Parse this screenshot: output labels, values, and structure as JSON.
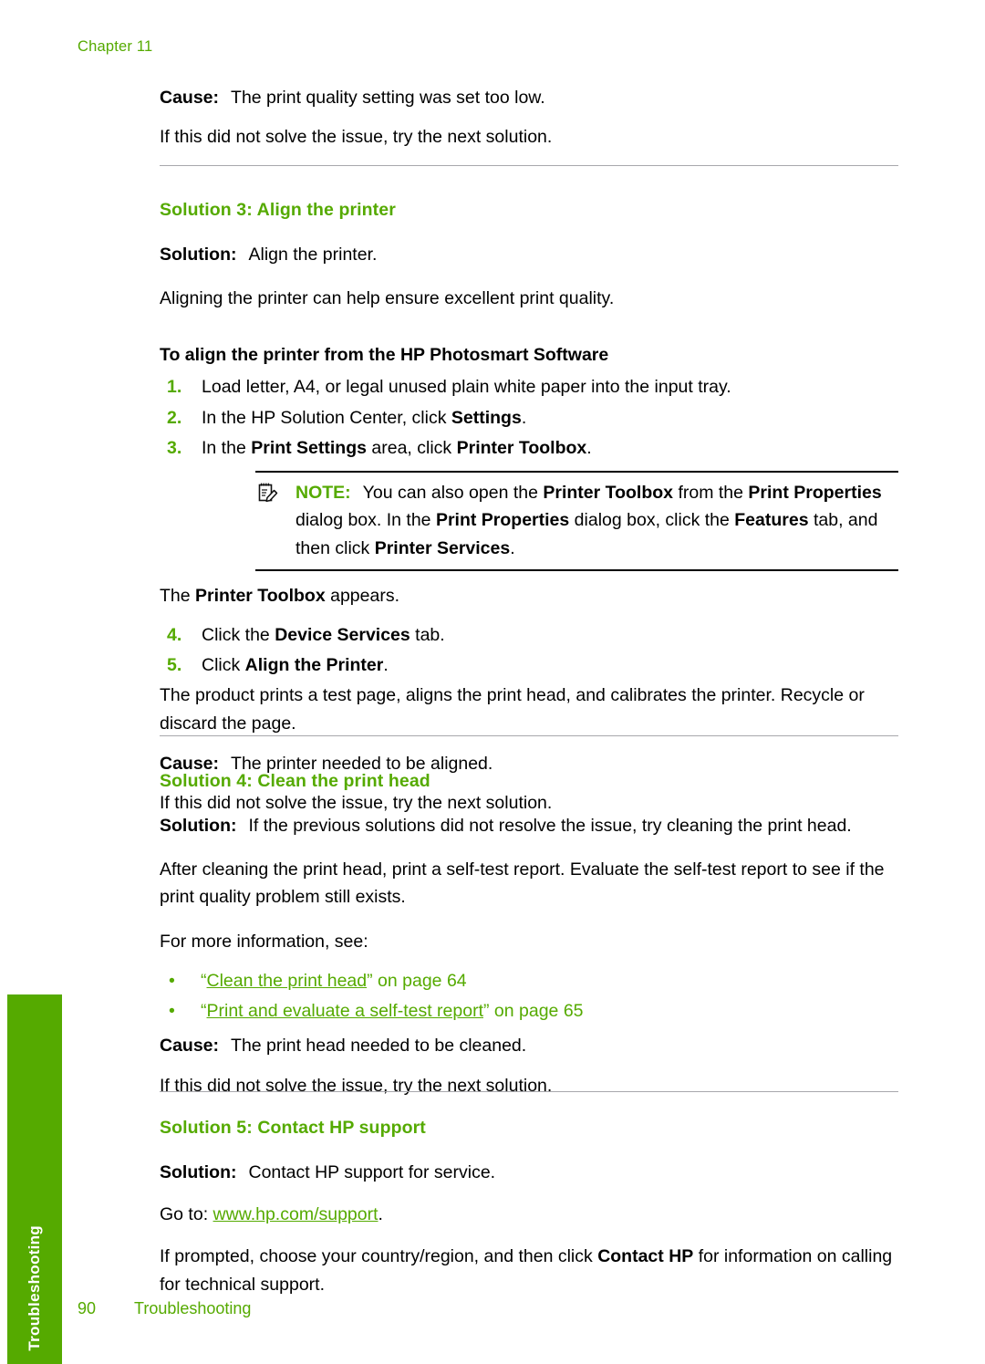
{
  "page": {
    "chapter_label": "Chapter 11",
    "footer_page_number": "90",
    "footer_section": "Troubleshooting",
    "side_tab_label": "Troubleshooting",
    "accent_green": "#55aa00",
    "rule_gray": "#a8a8ac",
    "text_black": "#000000"
  },
  "intro": {
    "cause_label": "Cause:",
    "cause_text": "The print quality setting was set too low.",
    "next_solution_text": "If this did not solve the issue, try the next solution."
  },
  "solution3": {
    "heading": "Solution 3: Align the printer",
    "solution_label": "Solution:",
    "solution_text": "Align the printer.",
    "paragraph": "Aligning the printer can help ensure excellent print quality.",
    "procedure_heading": "To align the printer from the HP Photosmart Software",
    "steps": [
      {
        "num": "1.",
        "parts": [
          {
            "t": "Load letter, A4, or legal unused plain white paper into the input tray.",
            "b": false
          }
        ]
      },
      {
        "num": "2.",
        "parts": [
          {
            "t": "In the HP Solution Center, click ",
            "b": false
          },
          {
            "t": "Settings",
            "b": true
          },
          {
            "t": ".",
            "b": false
          }
        ]
      },
      {
        "num": "3.",
        "parts": [
          {
            "t": "In the ",
            "b": false
          },
          {
            "t": "Print Settings",
            "b": true
          },
          {
            "t": " area, click ",
            "b": false
          },
          {
            "t": "Printer Toolbox",
            "b": true
          },
          {
            "t": ".",
            "b": false
          }
        ]
      }
    ],
    "note": {
      "icon": "note-pencil-icon",
      "label": "NOTE:",
      "parts": [
        {
          "t": "You can also open the ",
          "b": false
        },
        {
          "t": "Printer Toolbox",
          "b": true
        },
        {
          "t": " from the ",
          "b": false
        },
        {
          "t": "Print Properties",
          "b": true
        },
        {
          "t": " dialog box. In the ",
          "b": false
        },
        {
          "t": "Print Properties",
          "b": true
        },
        {
          "t": " dialog box, click the ",
          "b": false
        },
        {
          "t": "Features",
          "b": true
        },
        {
          "t": " tab, and then click ",
          "b": false
        },
        {
          "t": "Printer Services",
          "b": true
        },
        {
          "t": ".",
          "b": false
        }
      ]
    },
    "after_note": [
      {
        "t": "The ",
        "b": false
      },
      {
        "t": "Printer Toolbox",
        "b": true
      },
      {
        "t": " appears.",
        "b": false
      }
    ],
    "steps2": [
      {
        "num": "4.",
        "parts": [
          {
            "t": "Click the ",
            "b": false
          },
          {
            "t": "Device Services",
            "b": true
          },
          {
            "t": " tab.",
            "b": false
          }
        ]
      },
      {
        "num": "5.",
        "parts": [
          {
            "t": "Click ",
            "b": false
          },
          {
            "t": "Align the Printer",
            "b": true
          },
          {
            "t": ".",
            "b": false
          }
        ]
      }
    ],
    "step5_continuation": "The product prints a test page, aligns the print head, and calibrates the printer. Recycle or discard the page.",
    "cause_label": "Cause:",
    "cause_text": "The printer needed to be aligned.",
    "next_solution_text": "If this did not solve the issue, try the next solution."
  },
  "solution4": {
    "heading": "Solution 4: Clean the print head",
    "solution_label": "Solution:",
    "solution_text": "If the previous solutions did not resolve the issue, try cleaning the print head.",
    "paragraph": "After cleaning the print head, print a self-test report. Evaluate the self-test report to see if the print quality problem still exists.",
    "see_also_lead": "For more information, see:",
    "links": [
      {
        "quote_open": "“",
        "link_text": "Clean the print head",
        "quote_close": "”",
        "tail": " on page 64"
      },
      {
        "quote_open": "“",
        "link_text": "Print and evaluate a self-test report",
        "quote_close": "”",
        "tail": " on page 65"
      }
    ],
    "cause_label": "Cause:",
    "cause_text": "The print head needed to be cleaned.",
    "next_solution_text": "If this did not solve the issue, try the next solution."
  },
  "solution5": {
    "heading": "Solution 5: Contact HP support",
    "solution_label": "Solution:",
    "solution_text": "Contact HP support for service.",
    "goto_lead": "Go to: ",
    "goto_url": "www.hp.com/support",
    "goto_tail": ".",
    "final_parts": [
      {
        "t": "If prompted, choose your country/region, and then click ",
        "b": false
      },
      {
        "t": "Contact HP",
        "b": true
      },
      {
        "t": " for information on calling for technical support.",
        "b": false
      }
    ]
  }
}
